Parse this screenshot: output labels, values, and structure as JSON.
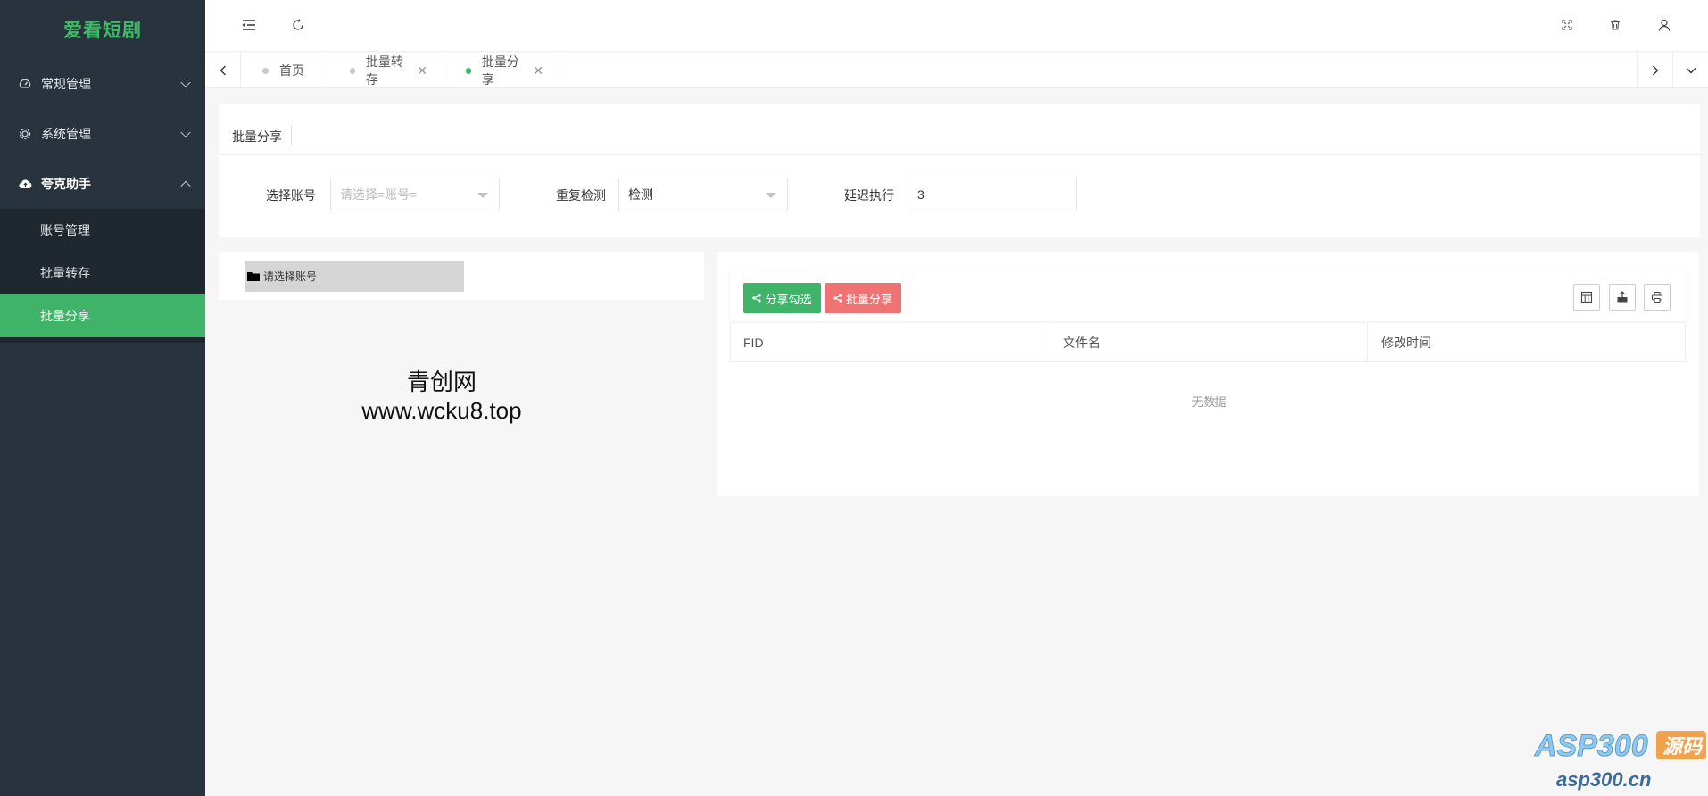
{
  "app": {
    "logo": "爱看短剧"
  },
  "sidebar": {
    "groups": [
      {
        "label": "常规管理",
        "icon": "dashboard-icon",
        "expanded": false
      },
      {
        "label": "系统管理",
        "icon": "gear-icon",
        "expanded": false
      },
      {
        "label": "夸克助手",
        "icon": "cloud-icon",
        "expanded": true
      }
    ],
    "submenu": [
      {
        "label": "账号管理",
        "active": false
      },
      {
        "label": "批量转存",
        "active": false
      },
      {
        "label": "批量分享",
        "active": true
      }
    ]
  },
  "tabs": [
    {
      "label": "首页",
      "closable": false,
      "active": false
    },
    {
      "label": "批量转存",
      "closable": true,
      "active": false
    },
    {
      "label": "批量分享",
      "closable": true,
      "active": true
    }
  ],
  "form": {
    "title": "批量分享",
    "account_label": "选择账号",
    "account_placeholder": "请选择=账号=",
    "dup_label": "重复检测",
    "dup_value": "检测",
    "delay_label": "延迟执行",
    "delay_value": "3"
  },
  "tree": {
    "node_label": "请选择账号"
  },
  "watermark": {
    "line1": "青创网",
    "line2": "www.wcku8.top"
  },
  "table": {
    "share_selected_btn": "分享勾选",
    "batch_share_btn": "批量分享",
    "columns": [
      "FID",
      "文件名",
      "修改时间"
    ],
    "empty_text": "无数据"
  },
  "corner_logo": {
    "brand": "ASP300",
    "tag": "源码",
    "url": "asp300.cn"
  },
  "colors": {
    "accent": "#3fb468",
    "danger": "#f07374",
    "sidebar": "#28333e"
  }
}
